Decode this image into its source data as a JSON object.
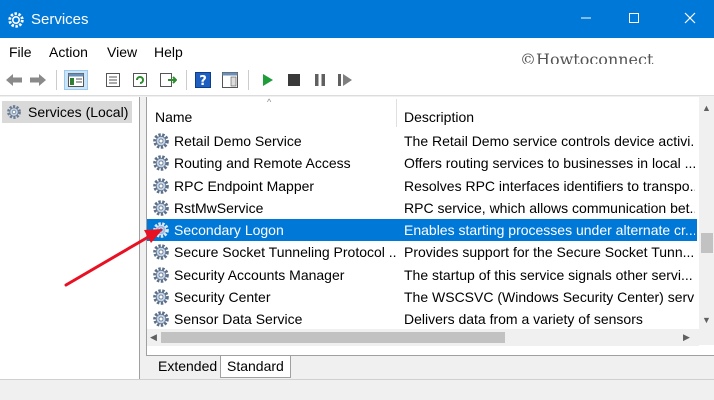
{
  "window": {
    "title": "Services",
    "minimize_icon": "minimize-icon",
    "maximize_icon": "maximize-icon",
    "close_icon": "close-icon"
  },
  "menu": {
    "items": [
      "File",
      "Action",
      "View",
      "Help"
    ]
  },
  "watermark": "©Howtoconnect",
  "toolbar": {
    "buttons": [
      "back-icon",
      "forward-icon",
      "show-hide-console-tree-icon",
      "properties-icon",
      "refresh-icon",
      "export-list-icon",
      "help-icon",
      "show-hide-action-pane-icon",
      "start-service-icon",
      "stop-service-icon",
      "pause-service-icon",
      "restart-service-icon"
    ]
  },
  "tree": {
    "root_label": "Services (Local)"
  },
  "list": {
    "columns": {
      "name": "Name",
      "description": "Description"
    },
    "rows": [
      {
        "name": "Retail Demo Service",
        "description": "The Retail Demo service controls device activi..."
      },
      {
        "name": "Routing and Remote Access",
        "description": "Offers routing services to businesses in local ..."
      },
      {
        "name": "RPC Endpoint Mapper",
        "description": "Resolves RPC interfaces identifiers to transpo..."
      },
      {
        "name": "RstMwService",
        "description": "RPC service, which allows communication bet..."
      },
      {
        "name": "Secondary Logon",
        "description": "Enables starting processes under alternate cr...",
        "selected": true
      },
      {
        "name": "Secure Socket Tunneling Protocol ...",
        "description": "Provides support for the Secure Socket Tunn..."
      },
      {
        "name": "Security Accounts Manager",
        "description": "The startup of this service signals other servi..."
      },
      {
        "name": "Security Center",
        "description": "The WSCSVC (Windows Security Center) servi..."
      },
      {
        "name": "Sensor Data Service",
        "description": "Delivers data from a variety of sensors"
      }
    ]
  },
  "tabs": {
    "extended": "Extended",
    "standard": "Standard",
    "active": "Standard"
  },
  "colors": {
    "titlebar": "#0078d7",
    "selection": "#0078d7",
    "annotation_arrow": "#e81123"
  }
}
